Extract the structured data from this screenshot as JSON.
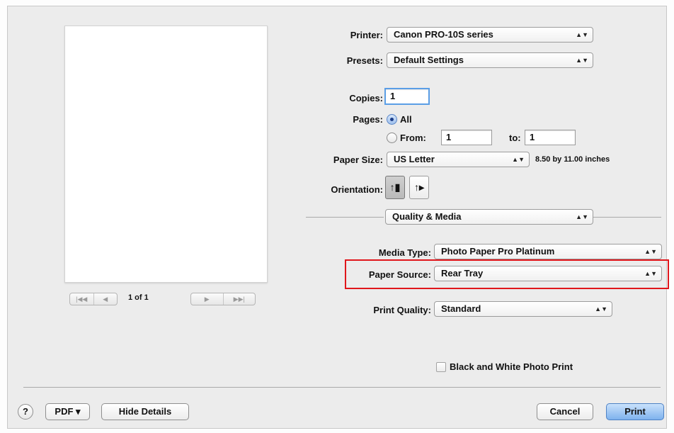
{
  "printer": {
    "label": "Printer:",
    "value": "Canon PRO-10S series"
  },
  "presets": {
    "label": "Presets:",
    "value": "Default Settings"
  },
  "copies": {
    "label": "Copies:",
    "value": "1"
  },
  "pages": {
    "label": "Pages:",
    "all_label": "All",
    "from_label": "From:",
    "from_value": "1",
    "to_label": "to:",
    "to_value": "1",
    "selected": "All"
  },
  "paper_size": {
    "label": "Paper Size:",
    "value": "US Letter",
    "dimensions": "8.50 by 11.00 inches"
  },
  "orientation": {
    "label": "Orientation:",
    "selected": "portrait"
  },
  "section": {
    "value": "Quality & Media"
  },
  "media_type": {
    "label": "Media Type:",
    "value": "Photo Paper Pro Platinum"
  },
  "paper_source": {
    "label": "Paper Source:",
    "value": "Rear Tray"
  },
  "print_quality": {
    "label": "Print Quality:",
    "value": "Standard"
  },
  "bw_photo_print": {
    "label": "Black and White Photo Print",
    "checked": false
  },
  "preview": {
    "page_indicator": "1 of 1"
  },
  "footer": {
    "help": "?",
    "pdf_label": "PDF ▾",
    "hide_details_label": "Hide Details",
    "cancel_label": "Cancel",
    "print_label": "Print"
  },
  "colors": {
    "highlight": "#e0161b",
    "default_button": "#7eb2ee"
  }
}
